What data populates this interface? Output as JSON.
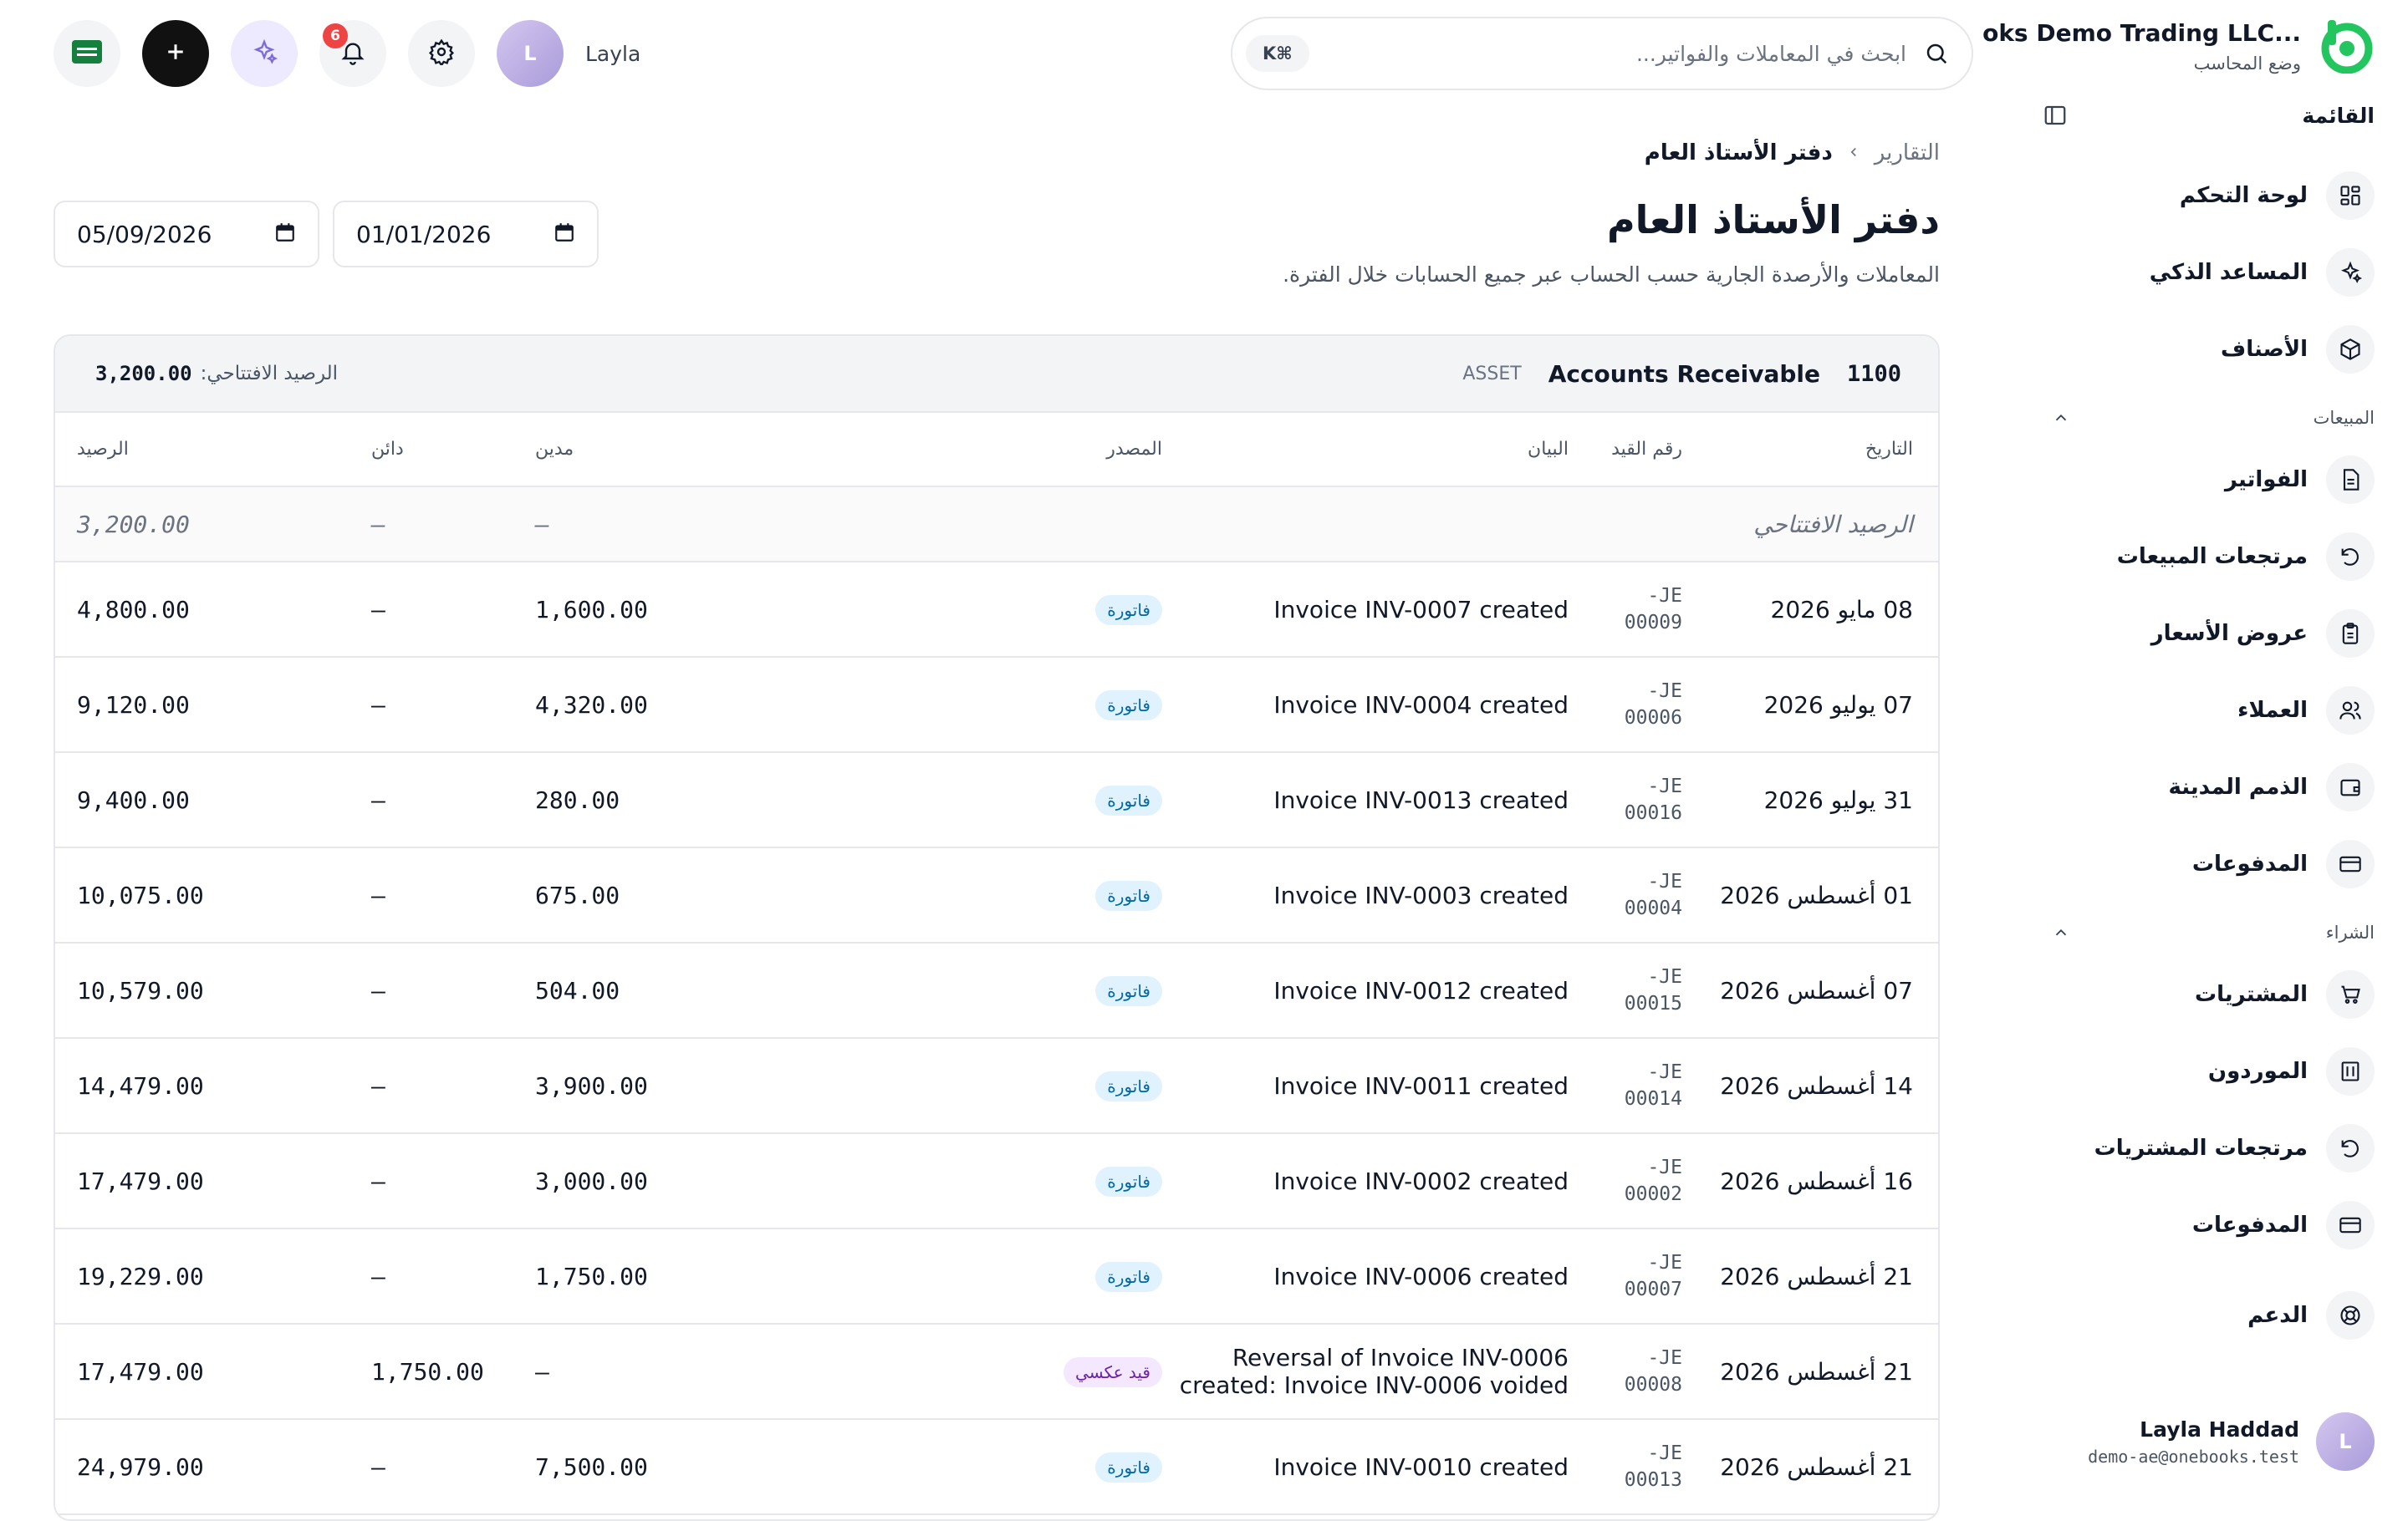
{
  "brand": {
    "name": "...oks Demo Trading LLC",
    "mode": "وضع المحاسب"
  },
  "menu": {
    "title": "القائمة"
  },
  "nav": {
    "main": [
      {
        "label": "لوحة التحكم",
        "icon": "dashboard-icon"
      },
      {
        "label": "المساعد الذكي",
        "icon": "sparkles-icon"
      },
      {
        "label": "الأصناف",
        "icon": "box-icon"
      }
    ],
    "sales": {
      "label": "المبيعات",
      "items": [
        {
          "label": "الفواتير",
          "icon": "document-icon"
        },
        {
          "label": "مرتجعات المبيعات",
          "icon": "undo-icon"
        },
        {
          "label": "عروض الأسعار",
          "icon": "clipboard-icon"
        },
        {
          "label": "العملاء",
          "icon": "users-icon"
        },
        {
          "label": "الذمم المدينة",
          "icon": "wallet-icon"
        },
        {
          "label": "المدفوعات",
          "icon": "card-icon"
        }
      ]
    },
    "purchases": {
      "label": "الشراء",
      "items": [
        {
          "label": "المشتريات",
          "icon": "cart-icon"
        },
        {
          "label": "الموردون",
          "icon": "building-icon"
        },
        {
          "label": "مرتجعات المشتريات",
          "icon": "undo-icon"
        },
        {
          "label": "المدفوعات",
          "icon": "card-icon"
        }
      ]
    },
    "support": {
      "label": "الدعم",
      "icon": "lifebuoy-icon"
    }
  },
  "profile": {
    "initial": "L",
    "name": "Layla Haddad",
    "email": "demo-ae@onebooks.test"
  },
  "topbar": {
    "search_placeholder": "ابحث في المعاملات والفواتير...",
    "shortcut": "⌘K",
    "notifications_count": "6",
    "user_name": "Layla",
    "user_initial": "L"
  },
  "page": {
    "breadcrumb_parent": "التقارير",
    "breadcrumb_current": "دفتر الأستاذ العام",
    "title": "دفتر الأستاذ العام",
    "subtitle": "المعاملات والأرصدة الجارية حسب الحساب عبر جميع الحسابات خلال الفترة.",
    "date_from": "01/01/2026",
    "date_to": "05/09/2026"
  },
  "account": {
    "code": "1100",
    "name": "Accounts Receivable",
    "type": "ASSET",
    "opening_label": "الرصيد الافتتاحي:",
    "opening_value": "3,200.00"
  },
  "table": {
    "headers": {
      "date": "التاريخ",
      "je": "رقم القيد",
      "desc": "البيان",
      "source": "المصدر",
      "debit": "مدين",
      "credit": "دائن",
      "balance": "الرصيد"
    },
    "opening_row": {
      "label": "الرصيد الافتتاحي",
      "debit": "—",
      "credit": "—",
      "balance": "3,200.00"
    },
    "rows": [
      {
        "date": "08 مايو 2026",
        "je1": "JE-",
        "je2": "00009",
        "desc": "Invoice INV-0007 created",
        "source": "فاتورة",
        "debit": "1,600.00",
        "credit": "—",
        "balance": "4,800.00"
      },
      {
        "date": "07 يوليو 2026",
        "je1": "JE-",
        "je2": "00006",
        "desc": "Invoice INV-0004 created",
        "source": "فاتورة",
        "debit": "4,320.00",
        "credit": "—",
        "balance": "9,120.00"
      },
      {
        "date": "31 يوليو 2026",
        "je1": "JE-",
        "je2": "00016",
        "desc": "Invoice INV-0013 created",
        "source": "فاتورة",
        "debit": "280.00",
        "credit": "—",
        "balance": "9,400.00"
      },
      {
        "date": "01 أغسطس 2026",
        "je1": "JE-",
        "je2": "00004",
        "desc": "Invoice INV-0003 created",
        "source": "فاتورة",
        "debit": "675.00",
        "credit": "—",
        "balance": "10,075.00"
      },
      {
        "date": "07 أغسطس 2026",
        "je1": "JE-",
        "je2": "00015",
        "desc": "Invoice INV-0012 created",
        "source": "فاتورة",
        "debit": "504.00",
        "credit": "—",
        "balance": "10,579.00"
      },
      {
        "date": "14 أغسطس 2026",
        "je1": "JE-",
        "je2": "00014",
        "desc": "Invoice INV-0011 created",
        "source": "فاتورة",
        "debit": "3,900.00",
        "credit": "—",
        "balance": "14,479.00"
      },
      {
        "date": "16 أغسطس 2026",
        "je1": "JE-",
        "je2": "00002",
        "desc": "Invoice INV-0002 created",
        "source": "فاتورة",
        "debit": "3,000.00",
        "credit": "—",
        "balance": "17,479.00"
      },
      {
        "date": "21 أغسطس 2026",
        "je1": "JE-",
        "je2": "00007",
        "desc": "Invoice INV-0006 created",
        "source": "فاتورة",
        "debit": "1,750.00",
        "credit": "—",
        "balance": "19,229.00"
      },
      {
        "date": "21 أغسطس 2026",
        "je1": "JE-",
        "je2": "00008",
        "desc": "Reversal of Invoice INV-0006 created: Invoice INV-0006 voided",
        "source": "قيد عكسي",
        "debit": "—",
        "credit": "1,750.00",
        "balance": "17,479.00"
      },
      {
        "date": "21 أغسطس 2026",
        "je1": "JE-",
        "je2": "00013",
        "desc": "Invoice INV-0010 created",
        "source": "فاتورة",
        "debit": "7,500.00",
        "credit": "—",
        "balance": "24,979.00"
      }
    ]
  },
  "colors": {
    "brand": "#22c55e",
    "badge": "#ef4444",
    "source_tag": "#e0f2fe",
    "reversal_tag": "#f3e8ff"
  }
}
